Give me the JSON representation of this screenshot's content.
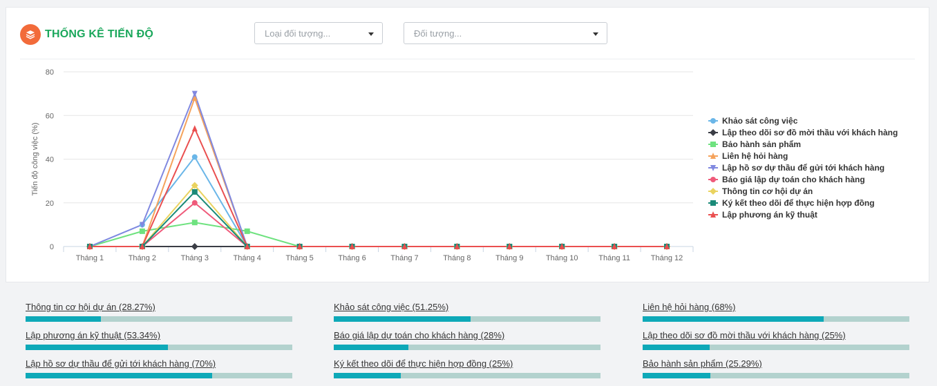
{
  "header": {
    "title": "THỐNG KÊ TIẾN ĐỘ",
    "icon": "layers-icon",
    "accent": "#1aa75b",
    "icon_bg": "#f26b3a"
  },
  "filters": {
    "object_type_placeholder": "Loại đối tượng...",
    "object_placeholder": "Đối tượng..."
  },
  "chart_data": {
    "type": "line",
    "ylabel": "Tiến độ công việc (%)",
    "xlabel": "",
    "ylim": [
      0,
      80
    ],
    "yticks": [
      0,
      20,
      40,
      60,
      80
    ],
    "grid": true,
    "legend_position": "right",
    "categories": [
      "Tháng 1",
      "Tháng 2",
      "Tháng 3",
      "Tháng 4",
      "Tháng 5",
      "Tháng 6",
      "Tháng 7",
      "Tháng 8",
      "Tháng 9",
      "Tháng 10",
      "Tháng 11",
      "Tháng 12"
    ],
    "series": [
      {
        "name": "Khảo sát công việc",
        "color": "#6ab6e8",
        "marker": "circle",
        "values": [
          0,
          10,
          41,
          0,
          0,
          0,
          0,
          0,
          0,
          0,
          0,
          0
        ]
      },
      {
        "name": "Lập theo dõi sơ đồ mời thầu với khách hàng",
        "color": "#3a3d45",
        "marker": "diamond",
        "values": [
          0,
          0,
          0,
          0,
          0,
          0,
          0,
          0,
          0,
          0,
          0,
          0
        ]
      },
      {
        "name": "Bảo hành sản phẩm",
        "color": "#6ee27f",
        "marker": "square",
        "values": [
          0,
          7,
          11,
          7,
          0,
          0,
          0,
          0,
          0,
          0,
          0,
          0
        ]
      },
      {
        "name": "Liên hệ hỏi hàng",
        "color": "#f5a25b",
        "marker": "triangle",
        "values": [
          0,
          0,
          68,
          0,
          0,
          0,
          0,
          0,
          0,
          0,
          0,
          0
        ]
      },
      {
        "name": "Lập hồ sơ dự thầu để gửi tới khách hàng",
        "color": "#8088e0",
        "marker": "triangle-down",
        "values": [
          0,
          10,
          70,
          0,
          0,
          0,
          0,
          0,
          0,
          0,
          0,
          0
        ]
      },
      {
        "name": "Báo giá lập dự toán cho khách hàng",
        "color": "#ef5a7a",
        "marker": "circle",
        "values": [
          0,
          0,
          20,
          0,
          0,
          0,
          0,
          0,
          0,
          0,
          0,
          0
        ]
      },
      {
        "name": "Thông tin cơ hội dự án",
        "color": "#ead35f",
        "marker": "diamond",
        "values": [
          0,
          0,
          28,
          0,
          0,
          0,
          0,
          0,
          0,
          0,
          0,
          0
        ]
      },
      {
        "name": "Ký kết theo dõi để thực hiện hợp đồng",
        "color": "#1a8a78",
        "marker": "square",
        "values": [
          0,
          0,
          25,
          0,
          0,
          0,
          0,
          0,
          0,
          0,
          0,
          0
        ]
      },
      {
        "name": "Lập phương án kỹ thuật",
        "color": "#ea4f4f",
        "marker": "triangle",
        "values": [
          0,
          0,
          54,
          0,
          0,
          0,
          0,
          0,
          0,
          0,
          0,
          0
        ]
      }
    ]
  },
  "progress": [
    {
      "label": "Thông tin cơ hội dự án (28.27%)",
      "value": 28.27
    },
    {
      "label": "Khảo sát công việc (51.25%)",
      "value": 51.25
    },
    {
      "label": "Liên hệ hỏi hàng (68%)",
      "value": 68
    },
    {
      "label": "Lập phương án kỹ thuật (53.34%)",
      "value": 53.34
    },
    {
      "label": "Báo giá lập dự toán cho khách hàng (28%)",
      "value": 28
    },
    {
      "label": "Lập theo dõi sơ đồ mời thầu với khách hàng (25%)",
      "value": 25
    },
    {
      "label": "Lập hồ sơ dự thầu để gửi tới khách hàng (70%)",
      "value": 70
    },
    {
      "label": "Ký kết theo dõi để thực hiện hợp đồng (25%)",
      "value": 25
    },
    {
      "label": "Bảo hành sản phẩm (25.29%)",
      "value": 25.29
    }
  ],
  "colors": {
    "progress_fill": "#0ea9b8",
    "progress_track": "#b3d2ce"
  }
}
